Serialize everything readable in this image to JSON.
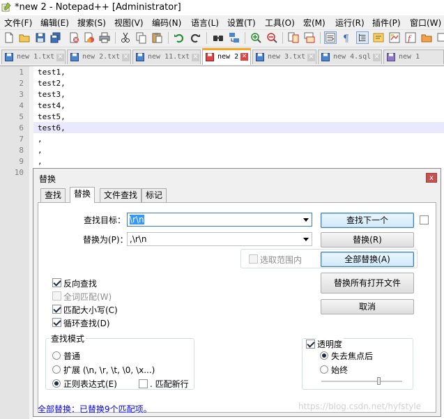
{
  "window": {
    "title": "*new 2 - Notepad++ [Administrator]"
  },
  "menu": [
    "文件(F)",
    "编辑(E)",
    "搜索(S)",
    "视图(V)",
    "编码(N)",
    "语言(L)",
    "设置(T)",
    "工具(O)",
    "宏(M)",
    "运行(R)",
    "插件(P)",
    "窗口(W)"
  ],
  "toolbar_icons": [
    "new-file-icon",
    "open-file-icon",
    "save-icon",
    "save-all-icon",
    "close-icon",
    "close-all-icon",
    "print-icon",
    "cut-icon",
    "copy-icon",
    "paste-icon",
    "undo-icon",
    "redo-icon",
    "find-icon",
    "replace-icon",
    "zoom-in-icon",
    "zoom-out-icon",
    "sync-vertical-icon",
    "sync-horizontal-icon",
    "word-wrap-icon",
    "show-all-chars-icon",
    "indent-guide-icon",
    "user-language-icon",
    "doc-map-icon",
    "function-list-icon",
    "folder-workspace-icon",
    "monitoring-icon"
  ],
  "tabs": [
    {
      "label": "new 1.txt",
      "active": false,
      "saved": true
    },
    {
      "label": "new 2.txt",
      "active": false,
      "saved": true
    },
    {
      "label": "new 11.txt",
      "active": false,
      "saved": true
    },
    {
      "label": "new 2",
      "active": true,
      "saved": false
    },
    {
      "label": "new 3.txt",
      "active": false,
      "saved": true
    },
    {
      "label": "new 4.sql",
      "active": false,
      "saved": true
    },
    {
      "label": "new 1",
      "active": false,
      "saved": true
    }
  ],
  "editor": {
    "lines": [
      "test1,",
      "test2,",
      "test3,",
      "test4,",
      "test5,",
      "test6,",
      ",",
      ",",
      ",",
      ""
    ],
    "line_numbers": [
      "1",
      "2",
      "3",
      "4",
      "5",
      "6",
      "7",
      "8",
      "9",
      "10"
    ],
    "current_line": 6
  },
  "dialog": {
    "title": "替换",
    "close_label": "x",
    "tabs": [
      "查找",
      "替换",
      "文件查找",
      "标记"
    ],
    "active_tab": "替换",
    "find_label": "查找目标：",
    "find_value": "\\r\\n",
    "replace_label": "替换为(P)：",
    "replace_value": ",\\r\\n",
    "in_selection_label": "选取范围内",
    "buttons": {
      "find_next": "查找下一个",
      "replace": "替换(R)",
      "replace_all": "全部替换(A)",
      "replace_all_open": "替换所有打开文件",
      "cancel": "取消"
    },
    "options": [
      {
        "label": "反向查找",
        "checked": true,
        "enabled": true
      },
      {
        "label": "全词匹配(W)",
        "checked": false,
        "enabled": false
      },
      {
        "label": "匹配大小写(C)",
        "checked": true,
        "enabled": true
      },
      {
        "label": "循环查找(D)",
        "checked": true,
        "enabled": true
      }
    ],
    "search_mode": {
      "title": "查找模式",
      "normal": "普通",
      "extended": "扩展 (\\n, \\r, \\t, \\0, \\x...)",
      "regex": "正则表达式(E)",
      "dot_newline": ". 匹配新行",
      "selected": "regex"
    },
    "transparency": {
      "label": "透明度",
      "checked": true,
      "on_lose_focus": "失去焦点后",
      "always": "始终",
      "mode": "on_lose_focus"
    },
    "status": "全部替换：已替换9个匹配项。"
  },
  "watermark": "https://blog.csdn.net/hyfstyle"
}
